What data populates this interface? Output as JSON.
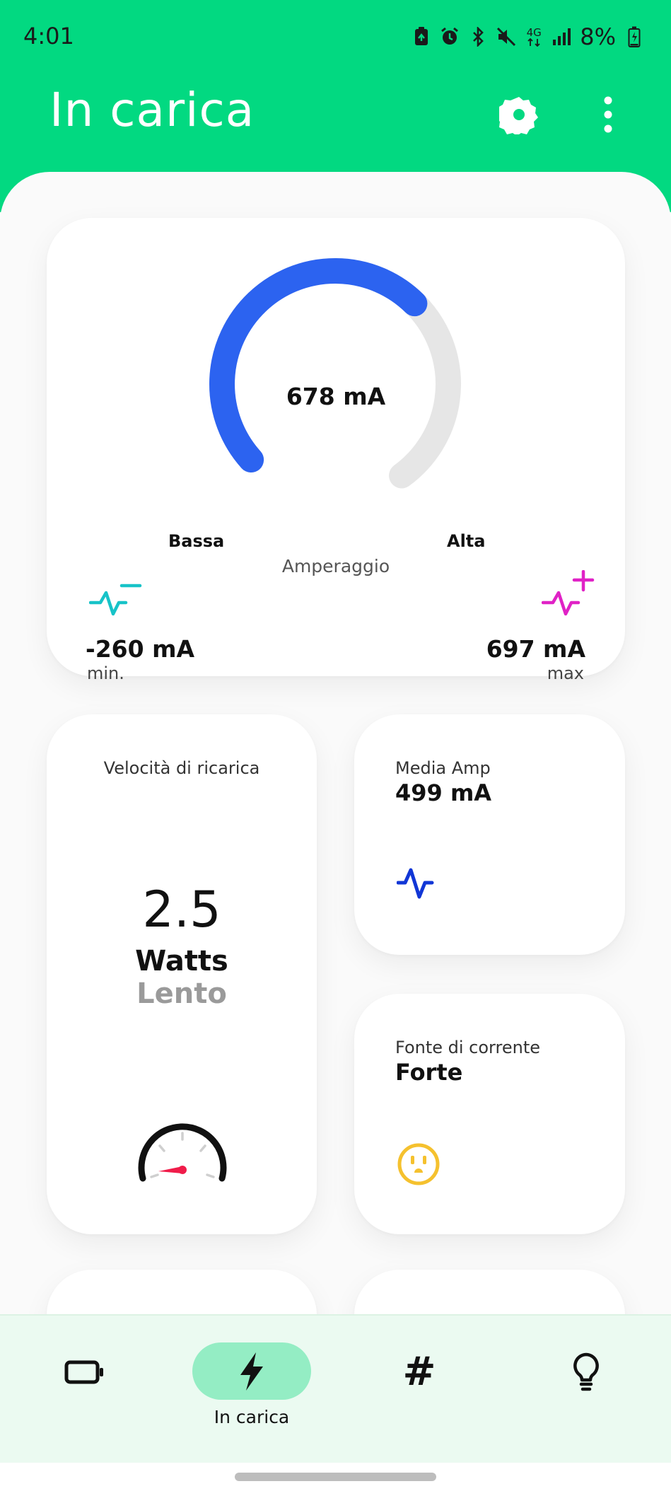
{
  "colors": {
    "header_green": "#02d981",
    "gauge_blue": "#2c63f0",
    "gauge_track": "#e6e6e6",
    "min_icon": "#17c3c8",
    "max_icon": "#e022c6",
    "avg_icon": "#1136d6",
    "source_icon": "#f5c12e",
    "speed_needle": "#f01c4a",
    "nav_active": "#94edc4"
  },
  "status_bar": {
    "time": "4:01",
    "network": "4G",
    "battery": "8%",
    "icons": [
      "battery-saver-icon",
      "alarm-icon",
      "bluetooth-icon",
      "mute-icon",
      "network-4g-icon",
      "signal-icon",
      "battery-charging-icon"
    ]
  },
  "header": {
    "title": "In carica",
    "settings_icon": "gear-icon",
    "menu_icon": "more-vert-icon"
  },
  "amperage": {
    "value": "678 mA",
    "value_fraction": 0.64,
    "low_label": "Bassa",
    "high_label": "Alta",
    "caption": "Amperaggio",
    "min_value": "-260 mA",
    "min_label": "min.",
    "max_value": "697 mA",
    "max_label": "max"
  },
  "speed": {
    "title": "Velocità di ricarica",
    "value": "2.5",
    "unit": "Watts",
    "status": "Lento",
    "icon": "speedometer-icon"
  },
  "average": {
    "title": "Media Amp",
    "value": "499 mA",
    "icon": "pulse-icon"
  },
  "source": {
    "title": "Fonte di corrente",
    "value": "Forte",
    "icon": "power-outlet-icon"
  },
  "bottom_nav": {
    "items": [
      {
        "icon": "battery-icon",
        "label": ""
      },
      {
        "icon": "bolt-icon",
        "label": "In carica",
        "active": true
      },
      {
        "icon": "hash-icon",
        "label": ""
      },
      {
        "icon": "lightbulb-icon",
        "label": ""
      }
    ],
    "hash_glyph": "#"
  }
}
